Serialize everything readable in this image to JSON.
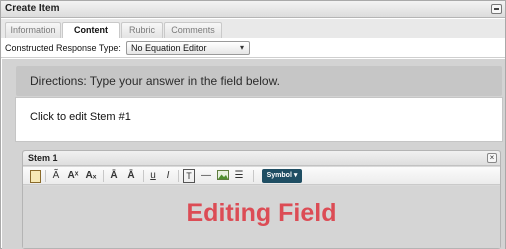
{
  "panel": {
    "title": "Create Item"
  },
  "tabs": [
    {
      "label": "Information",
      "active": false
    },
    {
      "label": "Content",
      "active": true
    },
    {
      "label": "Rubric",
      "active": false
    },
    {
      "label": "Comments",
      "active": false
    }
  ],
  "response_type": {
    "label": "Constructed Response Type:",
    "value": "No Equation Editor"
  },
  "directions": {
    "text": "Directions: Type your answer in the field below."
  },
  "stem_prompt": {
    "text": "Click to edit Stem #1"
  },
  "stem_panel": {
    "title": "Stem 1",
    "close_symbol": "×",
    "toolbar": {
      "bold_a": "Ã",
      "superscript": "Aˣ",
      "subscript": "Aₓ",
      "strike_a": "Ā",
      "strike_a2": "Ā",
      "underline": "u",
      "italic": "I",
      "text_box": "T",
      "dash": "—",
      "list": "☰",
      "symbol_label": "Symbol ▾"
    },
    "editing_label": "Editing Field"
  },
  "colors": {
    "symbol_button": "#1f4e63",
    "editing_label": "#dc4c55",
    "directions_bg": "#c6c6c6"
  }
}
